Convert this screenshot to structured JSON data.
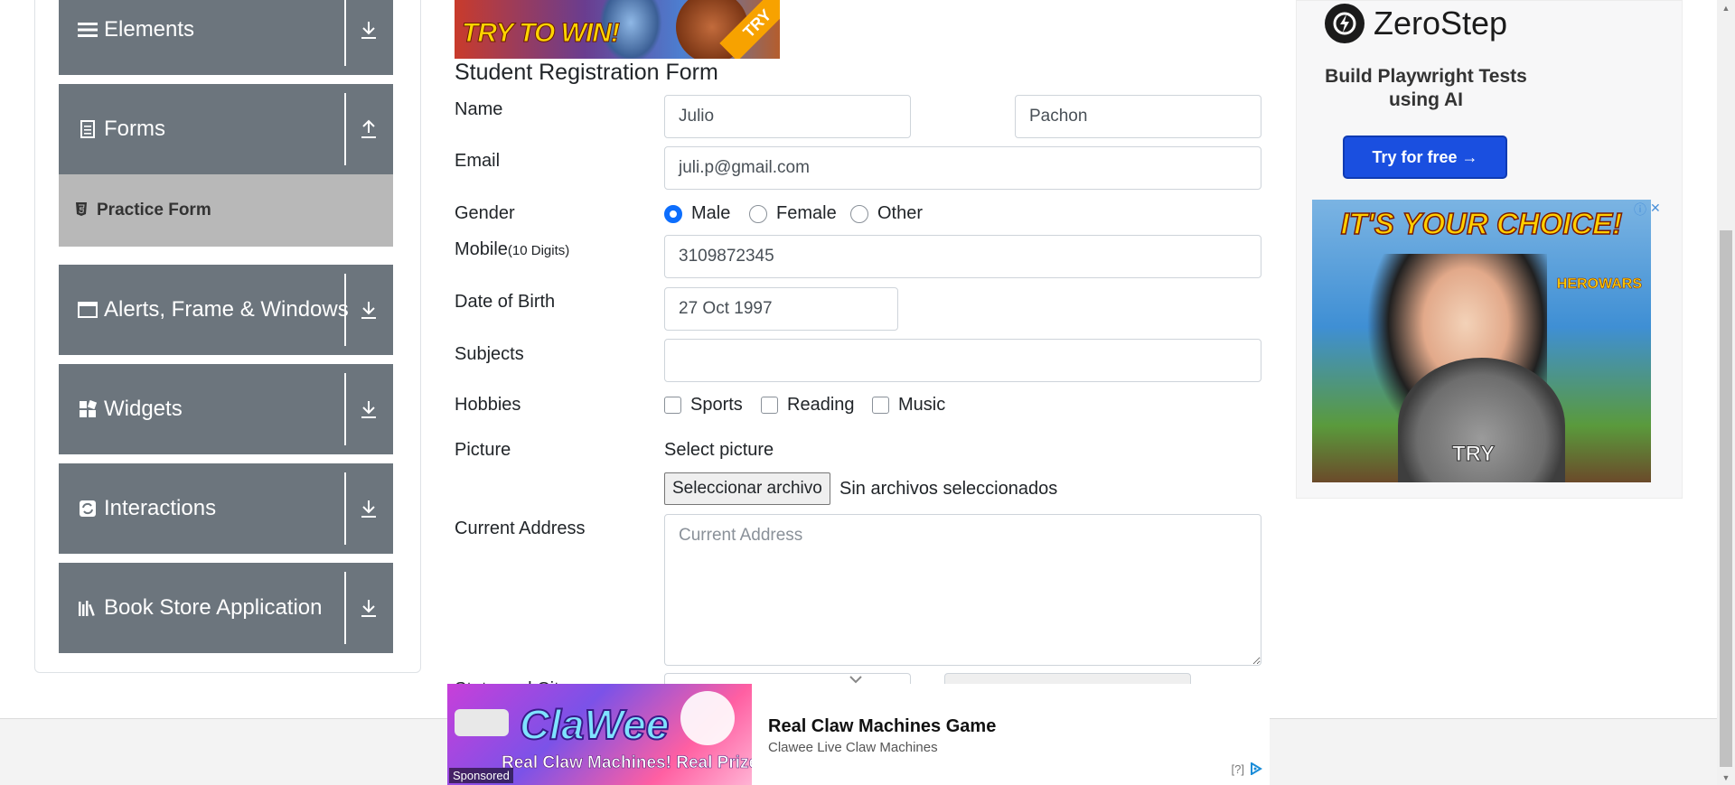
{
  "sidebar": {
    "groups": [
      {
        "label": "Elements",
        "icon": "menu-icon",
        "arrow": "download-icon"
      },
      {
        "label": "Forms",
        "icon": "document-icon",
        "arrow": "upload-icon"
      },
      {
        "label": "Alerts, Frame & Windows",
        "icon": "window-icon",
        "arrow": "download-icon"
      },
      {
        "label": "Widgets",
        "icon": "grid-icon",
        "arrow": "download-icon"
      },
      {
        "label": "Interactions",
        "icon": "refresh-icon",
        "arrow": "download-icon"
      },
      {
        "label": "Book Store Application",
        "icon": "books-icon",
        "arrow": "download-icon"
      }
    ],
    "active_item": {
      "label": "Practice Form",
      "icon": "html5-icon"
    }
  },
  "top_banner": {
    "text": "TRY TO WIN!",
    "badge": "TRY"
  },
  "form": {
    "title": "Student Registration Form",
    "name_label": "Name",
    "first_name": "Julio",
    "last_name": "Pachon",
    "email_label": "Email",
    "email": "juli.p@gmail.com",
    "gender_label": "Gender",
    "gender_options": [
      "Male",
      "Female",
      "Other"
    ],
    "gender_selected": "Male",
    "mobile_label": "Mobile",
    "mobile_hint": "(10 Digits)",
    "mobile": "3109872345",
    "dob_label": "Date of Birth",
    "dob": "27 Oct 1997",
    "subjects_label": "Subjects",
    "subjects": "",
    "hobbies_label": "Hobbies",
    "hobbies": [
      "Sports",
      "Reading",
      "Music"
    ],
    "picture_label": "Picture",
    "picture_hint": "Select picture",
    "file_button": "Seleccionar archivo",
    "file_status": "Sin archivos seleccionados",
    "address_label": "Current Address",
    "address_placeholder": "Current Address",
    "state_city_label": "State and City"
  },
  "ads": {
    "zerostep": {
      "brand": "ZeroStep",
      "tagline": "Build Playwright Tests using AI",
      "button": "Try for free →"
    },
    "herowars": {
      "title": "IT'S YOUR CHOICE!",
      "logo": "HEROWARS",
      "cta": "TRY",
      "info": "ⓘ",
      "close": "✕"
    },
    "bottom": {
      "logo": "ClaWee",
      "image_text": "Real Claw Machines! Real Prizes!",
      "sponsored": "Sponsored",
      "title": "Real Claw Machines Game",
      "subtitle": "Clawee Live Claw Machines",
      "choices_q": "[?]",
      "choices_icon": "adchoices-icon"
    }
  },
  "colors": {
    "sidebar_bg": "#6c757d",
    "active_item_bg": "#b8b8b8",
    "radio_accent": "#0d6efd",
    "cta_blue": "#1a4fe0"
  }
}
